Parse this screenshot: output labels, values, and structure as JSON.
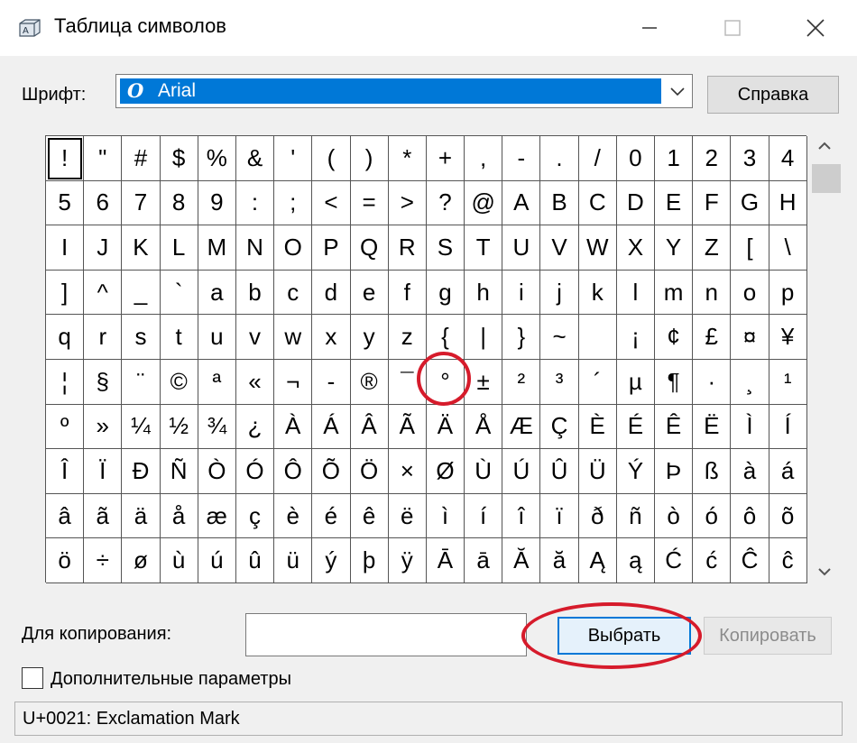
{
  "window": {
    "title": "Таблица символов",
    "icon": "charmap-app-icon",
    "controls": [
      "minimize-icon",
      "maximize-icon",
      "close-icon"
    ]
  },
  "font": {
    "label": "Шрифт:",
    "selected": "Arial",
    "help_button": "Справка"
  },
  "characters": [
    "!",
    "\"",
    "#",
    "$",
    "%",
    "&",
    "'",
    "(",
    ")",
    "*",
    "+",
    ",",
    "-",
    ".",
    "/",
    "0",
    "1",
    "2",
    "3",
    "4",
    "5",
    "6",
    "7",
    "8",
    "9",
    ":",
    ";",
    "<",
    "=",
    ">",
    "?",
    "@",
    "A",
    "B",
    "C",
    "D",
    "E",
    "F",
    "G",
    "H",
    "I",
    "J",
    "K",
    "L",
    "M",
    "N",
    "O",
    "P",
    "Q",
    "R",
    "S",
    "T",
    "U",
    "V",
    "W",
    "X",
    "Y",
    "Z",
    "[",
    "\\",
    "]",
    "^",
    "_",
    "`",
    "a",
    "b",
    "c",
    "d",
    "e",
    "f",
    "g",
    "h",
    "i",
    "j",
    "k",
    "l",
    "m",
    "n",
    "o",
    "p",
    "q",
    "r",
    "s",
    "t",
    "u",
    "v",
    "w",
    "x",
    "y",
    "z",
    "{",
    "|",
    "}",
    "~",
    "",
    "¡",
    "¢",
    "£",
    "¤",
    "¥",
    "¦",
    "§",
    "¨",
    "©",
    "ª",
    "«",
    "¬",
    "-",
    "®",
    "¯",
    "°",
    "±",
    "²",
    "³",
    "´",
    "µ",
    "¶",
    "·",
    "¸",
    "¹",
    "º",
    "»",
    "¼",
    "½",
    "¾",
    "¿",
    "À",
    "Á",
    "Â",
    "Ã",
    "Ä",
    "Å",
    "Æ",
    "Ç",
    "È",
    "É",
    "Ê",
    "Ë",
    "Ì",
    "Í",
    "Î",
    "Ï",
    "Ð",
    "Ñ",
    "Ò",
    "Ó",
    "Ô",
    "Õ",
    "Ö",
    "×",
    "Ø",
    "Ù",
    "Ú",
    "Û",
    "Ü",
    "Ý",
    "Þ",
    "ß",
    "à",
    "á",
    "â",
    "ã",
    "ä",
    "å",
    "æ",
    "ç",
    "è",
    "é",
    "ê",
    "ë",
    "ì",
    "í",
    "î",
    "ï",
    "ð",
    "ñ",
    "ò",
    "ó",
    "ô",
    "õ",
    "ö",
    "÷",
    "ø",
    "ù",
    "ú",
    "û",
    "ü",
    "ý",
    "þ",
    "ÿ",
    "Ā",
    "ā",
    "Ă",
    "ă",
    "Ą",
    "ą",
    "Ć",
    "ć",
    "Ĉ",
    "ĉ"
  ],
  "selected_index": 0,
  "copy": {
    "label": "Для копирования:",
    "value": "",
    "select_button": "Выбрать",
    "copy_button": "Копировать"
  },
  "advanced": {
    "label": "Дополнительные параметры",
    "checked": false
  },
  "status_text": "U+0021: Exclamation Mark",
  "annotation_color": "#d61b2b",
  "accent_color": "#0078d7"
}
